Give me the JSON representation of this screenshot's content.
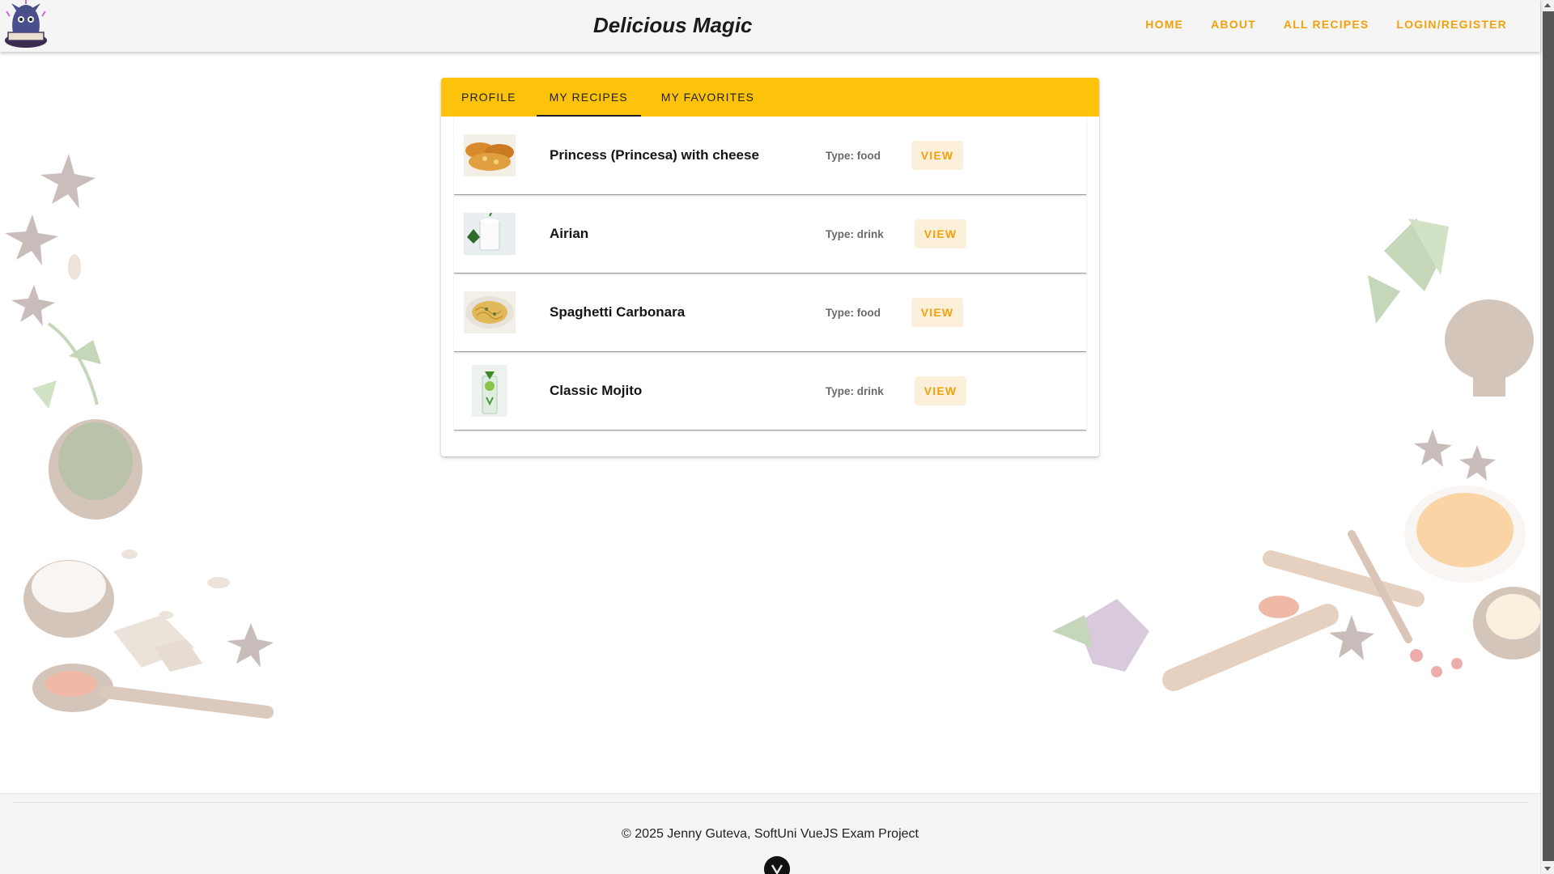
{
  "header": {
    "brand": "Delicious Magic",
    "nav": [
      "HOME",
      "ABOUT",
      "ALL RECIPES",
      "LOGIN/REGISTER"
    ]
  },
  "tabs": [
    {
      "label": "PROFILE"
    },
    {
      "label": "MY RECIPES"
    },
    {
      "label": "MY FAVORITES"
    }
  ],
  "recipes": [
    {
      "name": "Princess (Princesa) with cheese",
      "type": "Type: food",
      "action": "VIEW",
      "icon": "pastry-photo"
    },
    {
      "name": "Airian",
      "type": "Type: drink",
      "action": "VIEW",
      "icon": "yogurt-drink-photo"
    },
    {
      "name": "Spaghetti Carbonara",
      "type": "Type: food",
      "action": "VIEW",
      "icon": "pasta-photo"
    },
    {
      "name": "Classic Mojito",
      "type": "Type: drink",
      "action": "VIEW",
      "icon": "mojito-photo"
    }
  ],
  "footer": {
    "copyright": "© 2025 Jenny Guteva, SoftUni VueJS Exam Project"
  },
  "colors": {
    "accent": "#f2a10b",
    "tabbar": "#fdc30a",
    "button_bg": "#fdf0db"
  }
}
